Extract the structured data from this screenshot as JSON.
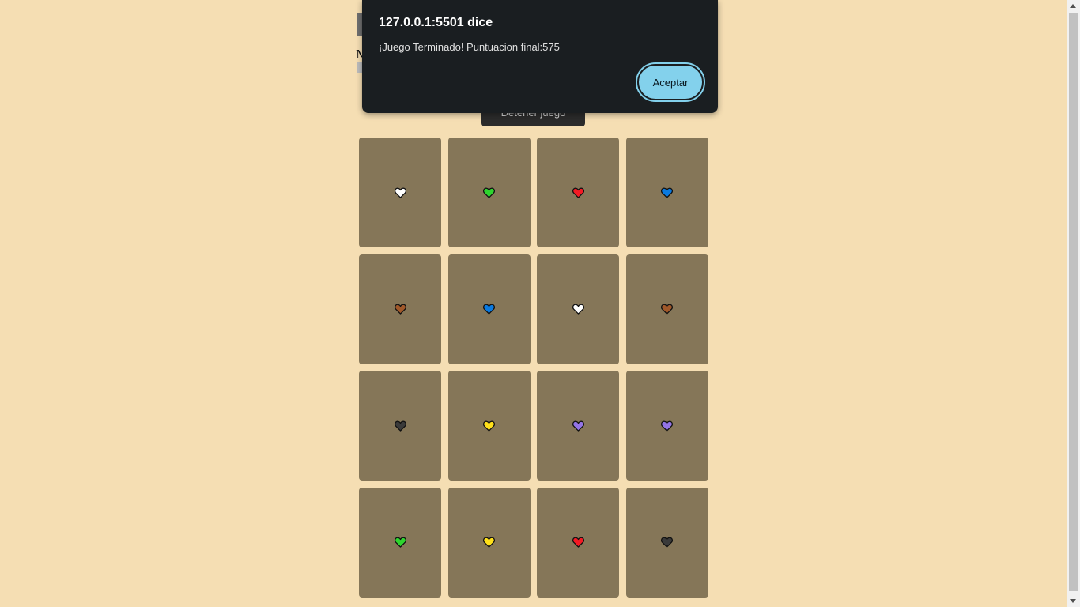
{
  "page": {
    "background": "#f5deb3",
    "stop_button_label": "Detener juego"
  },
  "dialog": {
    "title": "127.0.0.1:5501 dice",
    "message": "¡Juego Terminado! Puntuacion final:575",
    "accept_label": "Aceptar"
  },
  "cards": [
    {
      "icon": "heart-icon",
      "color": "#ffffff"
    },
    {
      "icon": "heart-icon",
      "color": "#2ed52e"
    },
    {
      "icon": "heart-icon",
      "color": "#f41a24"
    },
    {
      "icon": "heart-icon",
      "color": "#0a7ae0"
    },
    {
      "icon": "heart-icon",
      "color": "#a0582a"
    },
    {
      "icon": "heart-icon",
      "color": "#0a7ae0"
    },
    {
      "icon": "heart-icon",
      "color": "#ffffff"
    },
    {
      "icon": "heart-icon",
      "color": "#a0582a"
    },
    {
      "icon": "heart-icon",
      "color": "#3a3a3a"
    },
    {
      "icon": "heart-icon",
      "color": "#ffe01a"
    },
    {
      "icon": "heart-icon",
      "color": "#9474e6"
    },
    {
      "icon": "heart-icon",
      "color": "#9474e6"
    },
    {
      "icon": "heart-icon",
      "color": "#2ed52e"
    },
    {
      "icon": "heart-icon",
      "color": "#ffe01a"
    },
    {
      "icon": "heart-icon",
      "color": "#f41a24"
    },
    {
      "icon": "heart-icon",
      "color": "#3a3a3a"
    }
  ]
}
